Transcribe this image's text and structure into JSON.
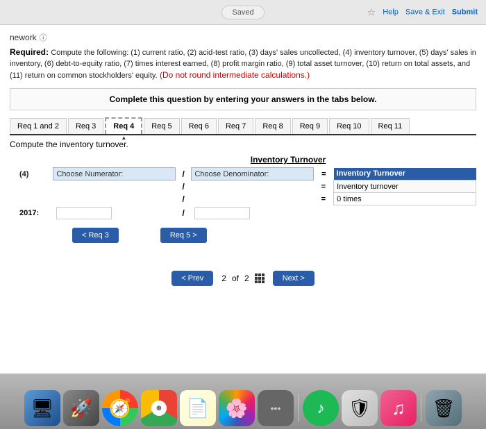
{
  "browser": {
    "saved_label": "Saved",
    "star_icon": "☆",
    "help_label": "Help",
    "save_exit_label": "Save & Exit",
    "submit_label": "Submit"
  },
  "header": {
    "app_name": "nework",
    "info_icon": "ⓘ"
  },
  "required": {
    "title": "Required:",
    "text": "Compute the following: (1) current ratio, (2) acid-test ratio, (3) days' sales uncollected, (4) inventory turnover, (5) days' sales in inventory, (6) debt-to-equity ratio, (7) times interest earned, (8) profit margin ratio, (9) total asset turnover, (10) return on total assets, and (11) return on common stockholders' equity.",
    "highlight": "(Do not round intermediate calculations.)"
  },
  "instruction": {
    "text": "Complete this question by entering your answers in the tabs below."
  },
  "tabs": [
    {
      "label": "Req 1 and 2",
      "active": false
    },
    {
      "label": "Req 3",
      "active": false
    },
    {
      "label": "Req 4",
      "active": true
    },
    {
      "label": "Req 5",
      "active": false
    },
    {
      "label": "Req 6",
      "active": false
    },
    {
      "label": "Req 7",
      "active": false
    },
    {
      "label": "Req 8",
      "active": false
    },
    {
      "label": "Req 9",
      "active": false
    },
    {
      "label": "Req 10",
      "active": false
    },
    {
      "label": "Req 11",
      "active": false
    }
  ],
  "compute_label": "Compute the inventory turnover.",
  "inventory_table": {
    "header": "Inventory Turnover",
    "row_label": "(4)",
    "choose_numerator": "Choose Numerator:",
    "slash": "/",
    "choose_denominator": "Choose Denominator:",
    "equals": "=",
    "result_header": "Inventory Turnover",
    "result_row1": "Inventory turnover",
    "result_row2_value": "0",
    "result_row2_unit": "times",
    "year_label": "2017:"
  },
  "navigation": {
    "req3_label": "< Req 3",
    "page_current": "2",
    "page_total": "2",
    "page_of": "of",
    "req5_label": "Req 5 >",
    "prev_label": "< Prev",
    "next_label": "Next >"
  },
  "dock": {
    "items": [
      {
        "name": "finder",
        "icon": "🖥",
        "label": "Finder"
      },
      {
        "name": "launchpad",
        "icon": "🚀",
        "label": "Launchpad"
      },
      {
        "name": "safari",
        "icon": "🧭",
        "label": "Safari"
      },
      {
        "name": "chrome",
        "icon": "⊕",
        "label": "Chrome"
      },
      {
        "name": "notes",
        "icon": "📝",
        "label": "Notes"
      },
      {
        "name": "photos",
        "icon": "🌸",
        "label": "Photos"
      },
      {
        "name": "more",
        "icon": "•••",
        "label": "More"
      },
      {
        "name": "spotify",
        "icon": "♪",
        "label": "Spotify"
      },
      {
        "name": "antivirus",
        "icon": "🛡",
        "label": "Antivirus"
      },
      {
        "name": "music",
        "icon": "♫",
        "label": "Music"
      },
      {
        "name": "trash",
        "icon": "🗑",
        "label": "Trash"
      }
    ]
  }
}
